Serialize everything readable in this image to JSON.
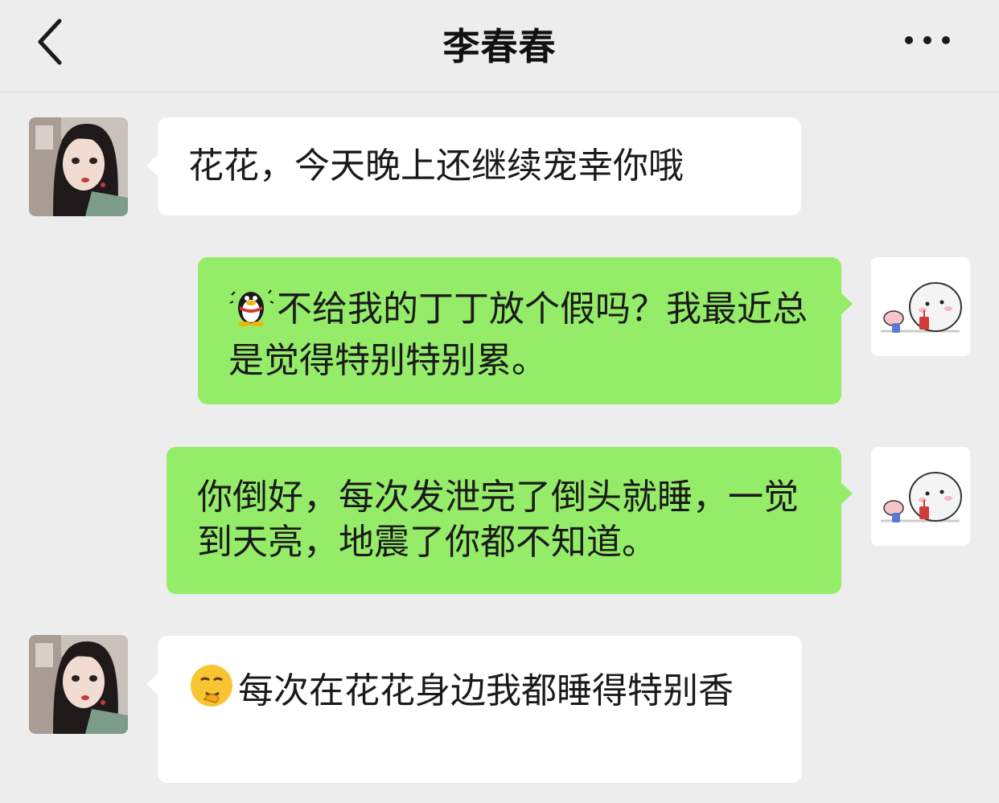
{
  "header": {
    "title": "李春春",
    "back_icon": "chevron-left-icon",
    "more_icon": "more-dots-icon"
  },
  "messages": [
    {
      "sender": "contact",
      "text": "花花，今天晚上还继续宠幸你哦"
    },
    {
      "sender": "me",
      "emoji": "qq-penguin-emoji",
      "text": "不给我的丁丁放个假吗？我最近总是觉得特别特别累。"
    },
    {
      "sender": "me",
      "text": "你倒好，每次发泄完了倒头就睡，一觉到天亮，地震了你都不知道。"
    },
    {
      "sender": "contact",
      "emoji": "smirk-face-emoji",
      "text": "每次在花花身边我都睡得特别香"
    }
  ],
  "colors": {
    "background": "#ededed",
    "bubble_me": "#95ec69",
    "bubble_contact": "#ffffff"
  }
}
